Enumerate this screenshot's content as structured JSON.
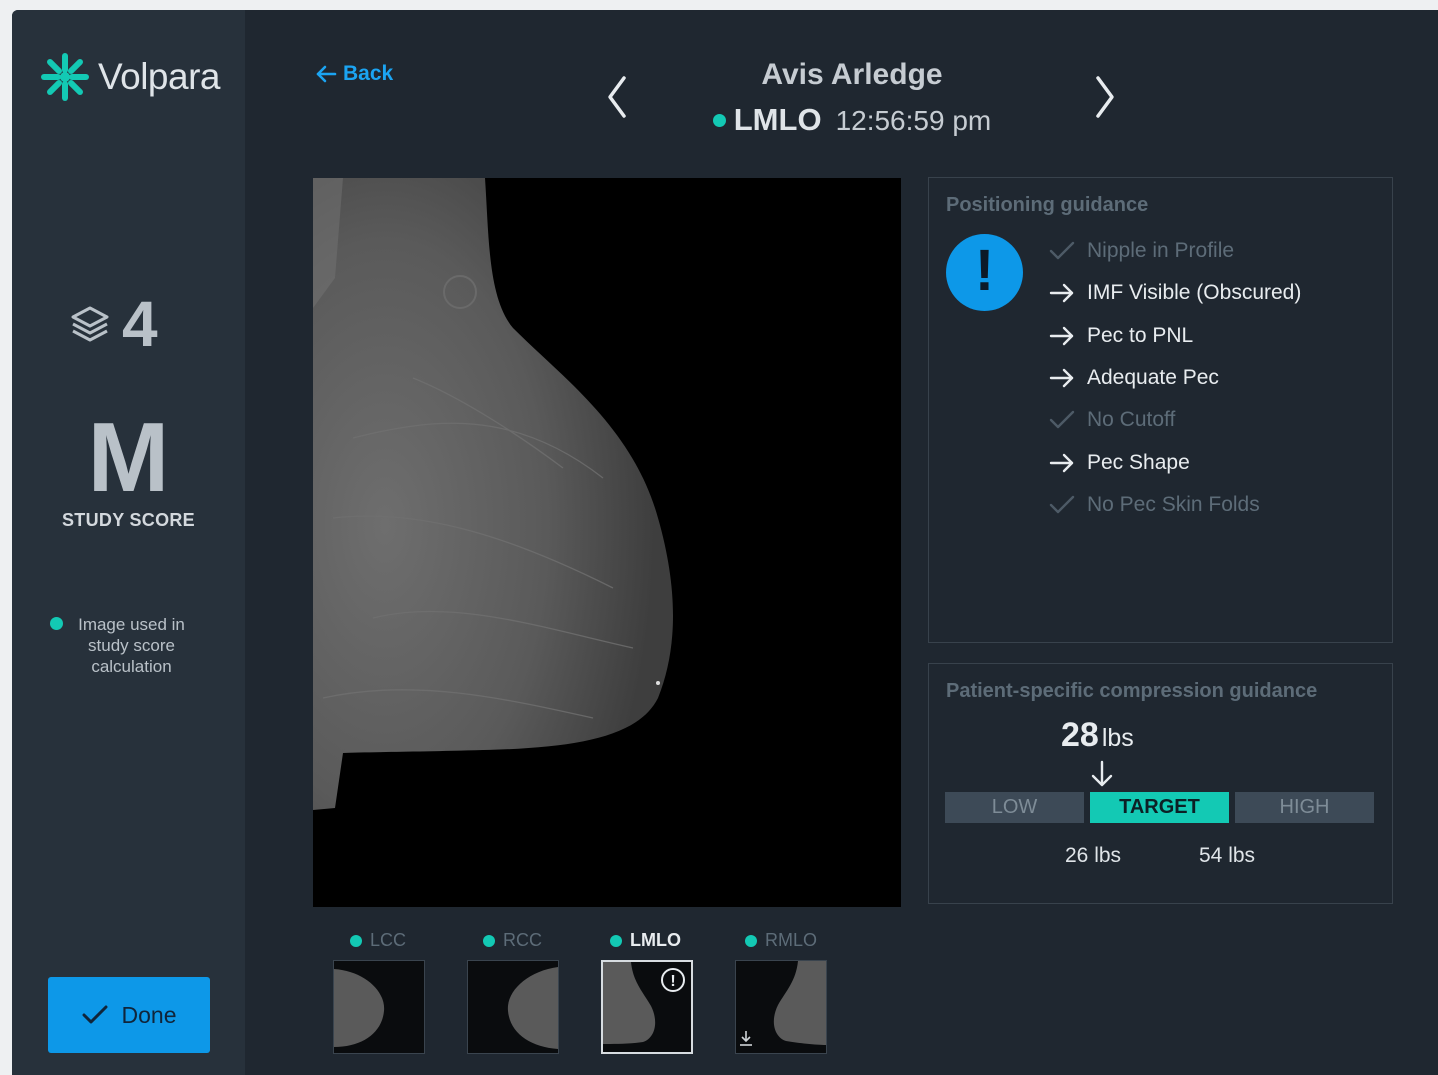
{
  "brand": {
    "name": "Volpara",
    "accent": "#13c9b4"
  },
  "sidebar": {
    "image_count": "4",
    "study_score": "M",
    "study_score_label": "STUDY SCORE",
    "legend_text": "Image used in study score calculation",
    "done_label": "Done"
  },
  "header": {
    "back_label": "Back",
    "patient_name": "Avis Arledge",
    "view": "LMLO",
    "time": "12:56:59 pm"
  },
  "positioning": {
    "title": "Positioning guidance",
    "items": [
      {
        "label": "Nipple in Profile",
        "status": "ok"
      },
      {
        "label": "IMF Visible (Obscured)",
        "status": "todo"
      },
      {
        "label": "Pec to PNL",
        "status": "todo"
      },
      {
        "label": "Adequate Pec",
        "status": "todo"
      },
      {
        "label": "No Cutoff",
        "status": "ok"
      },
      {
        "label": "Pec Shape",
        "status": "todo"
      },
      {
        "label": "No Pec Skin Folds",
        "status": "ok"
      }
    ]
  },
  "compression": {
    "title": "Patient-specific compression guidance",
    "value": "28",
    "unit": "lbs",
    "low_label": "LOW",
    "target_label": "TARGET",
    "high_label": "HIGH",
    "lower_bound": "26 lbs",
    "upper_bound": "54 lbs"
  },
  "thumbnails": [
    {
      "label": "LCC",
      "active": false
    },
    {
      "label": "RCC",
      "active": false
    },
    {
      "label": "LMLO",
      "active": true
    },
    {
      "label": "RMLO",
      "active": false
    }
  ]
}
